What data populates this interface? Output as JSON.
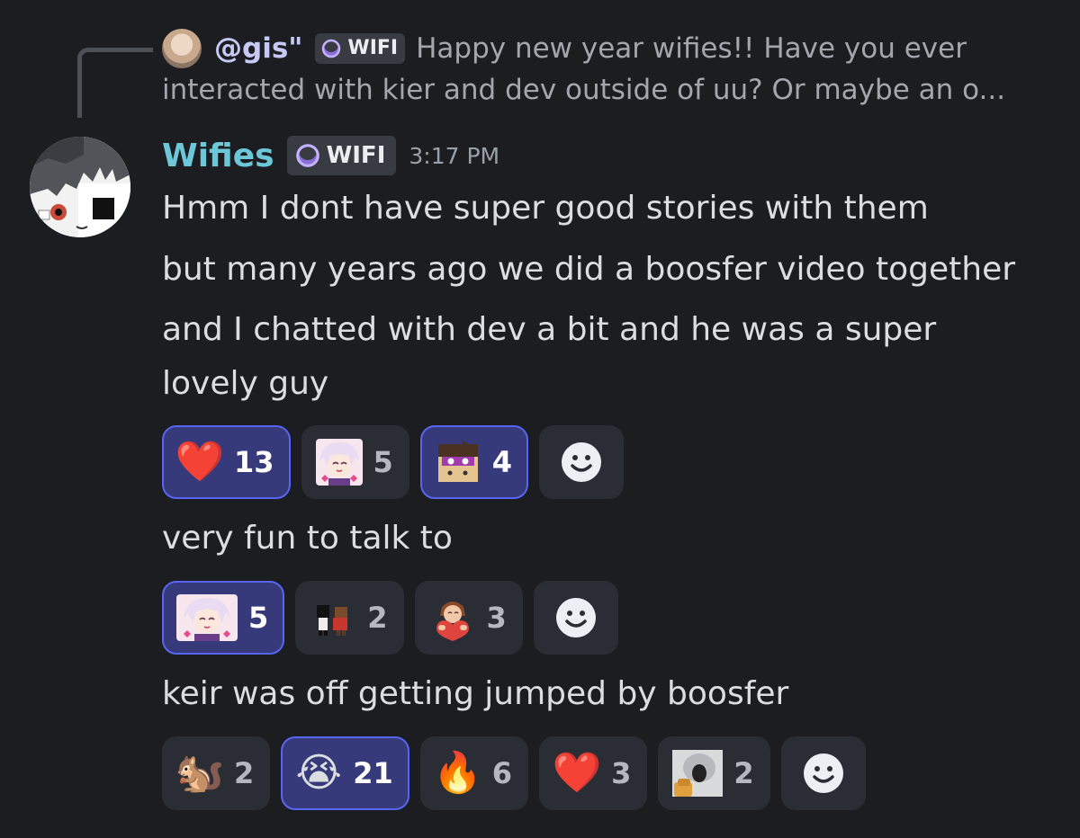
{
  "reply": {
    "username": "@gis\"",
    "tag": "WIFI",
    "line1": "Happy new year wifies!!  Have you ever",
    "line2": "interacted with kier and dev outside of uu? Or maybe an o..."
  },
  "message": {
    "username": "Wifies",
    "tag": "WIFI",
    "timestamp": "3:17 PM",
    "lines": [
      "Hmm I dont have super good stories with them",
      "but many years ago we did a boosfer video together",
      "and I chatted with dev a bit and he was a super",
      "lovely guy"
    ],
    "followups": [
      "very fun to talk to",
      "keir was off getting jumped by boosfer"
    ]
  },
  "reactions_1": [
    {
      "emoji": "❤️",
      "icon": "heart",
      "count": "13",
      "me": true
    },
    {
      "emoji": "",
      "icon": "anime-girl-emoji",
      "count": "5",
      "me": false
    },
    {
      "emoji": "",
      "icon": "blocky-face-emoji",
      "count": "4",
      "me": true
    }
  ],
  "reactions_2": [
    {
      "emoji": "",
      "icon": "anime-girl-emoji",
      "count": "5",
      "me": true
    },
    {
      "emoji": "",
      "icon": "pixel-hug-emoji",
      "count": "2",
      "me": false
    },
    {
      "emoji": "",
      "icon": "heart-hug-emoji",
      "count": "3",
      "me": false
    }
  ],
  "reactions_3": [
    {
      "emoji": "🐿️",
      "icon": "chipmunk",
      "count": "2",
      "me": false
    },
    {
      "emoji": "😭",
      "icon": "loudly-crying-face",
      "count": "21",
      "me": true
    },
    {
      "emoji": "🔥",
      "icon": "fire",
      "count": "6",
      "me": false
    },
    {
      "emoji": "❤️",
      "icon": "heart",
      "count": "3",
      "me": false
    },
    {
      "emoji": "",
      "icon": "screaming-photo-emoji",
      "count": "2",
      "me": false
    }
  ],
  "colors": {
    "background": "#1c1d21",
    "username": "#6cc8d8",
    "reaction_active": "#363a7a",
    "reaction_active_border": "#5865f2",
    "reaction": "#2b2d34"
  }
}
